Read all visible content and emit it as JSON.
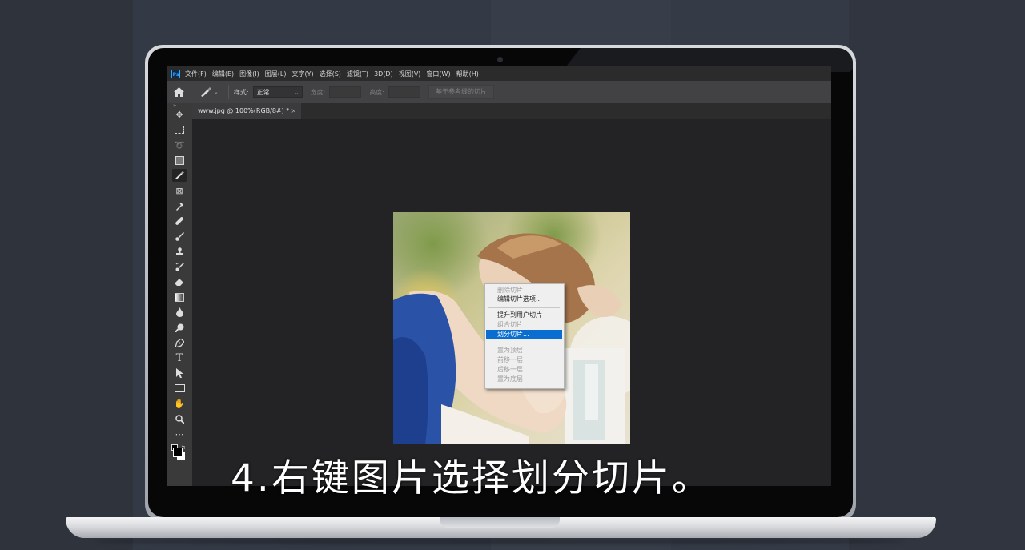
{
  "menubar": {
    "logo": "Ps",
    "items": [
      "文件(F)",
      "编辑(E)",
      "图像(I)",
      "图层(L)",
      "文字(Y)",
      "选择(S)",
      "滤镜(T)",
      "3D(D)",
      "视图(V)",
      "窗口(W)",
      "帮助(H)"
    ]
  },
  "options": {
    "style_label": "样式:",
    "style_value": "正常",
    "width_label": "宽度:",
    "height_label": "高度:",
    "guides_button": "基于参考线的切片"
  },
  "document": {
    "tab_title": "www.jpg @ 100%(RGB/8#) *",
    "tab_close": "×"
  },
  "context_menu": {
    "items": [
      {
        "label": "删除切片",
        "enabled": false
      },
      {
        "label": "编辑切片选项...",
        "enabled": true
      },
      {
        "label": "提升到用户切片",
        "enabled": true
      },
      {
        "label": "组合切片",
        "enabled": false
      },
      {
        "label": "划分切片...",
        "enabled": true,
        "highlighted": true
      },
      {
        "label": "置为顶层",
        "enabled": false
      },
      {
        "label": "前移一层",
        "enabled": false
      },
      {
        "label": "后移一层",
        "enabled": false
      },
      {
        "label": "置为底层",
        "enabled": false
      }
    ],
    "highlight_color": "#0a6ed1"
  },
  "subtitle": "4.右键图片选择划分切片。",
  "colors": {
    "background": "#323843",
    "screen": "#232325",
    "toolbar": "#3a3a3b"
  },
  "tools": [
    "move-icon",
    "marquee-icon",
    "lasso-icon",
    "object-select-icon",
    "slice-icon",
    "frame-icon",
    "eyedropper-icon",
    "healing-brush-icon",
    "brush-icon",
    "clone-stamp-icon",
    "history-brush-icon",
    "eraser-icon",
    "gradient-icon",
    "blur-icon",
    "dodge-icon",
    "pen-icon",
    "type-icon",
    "path-select-icon",
    "rectangle-icon",
    "hand-icon",
    "zoom-icon",
    "more-tools-icon",
    "color-swatches-icon"
  ]
}
